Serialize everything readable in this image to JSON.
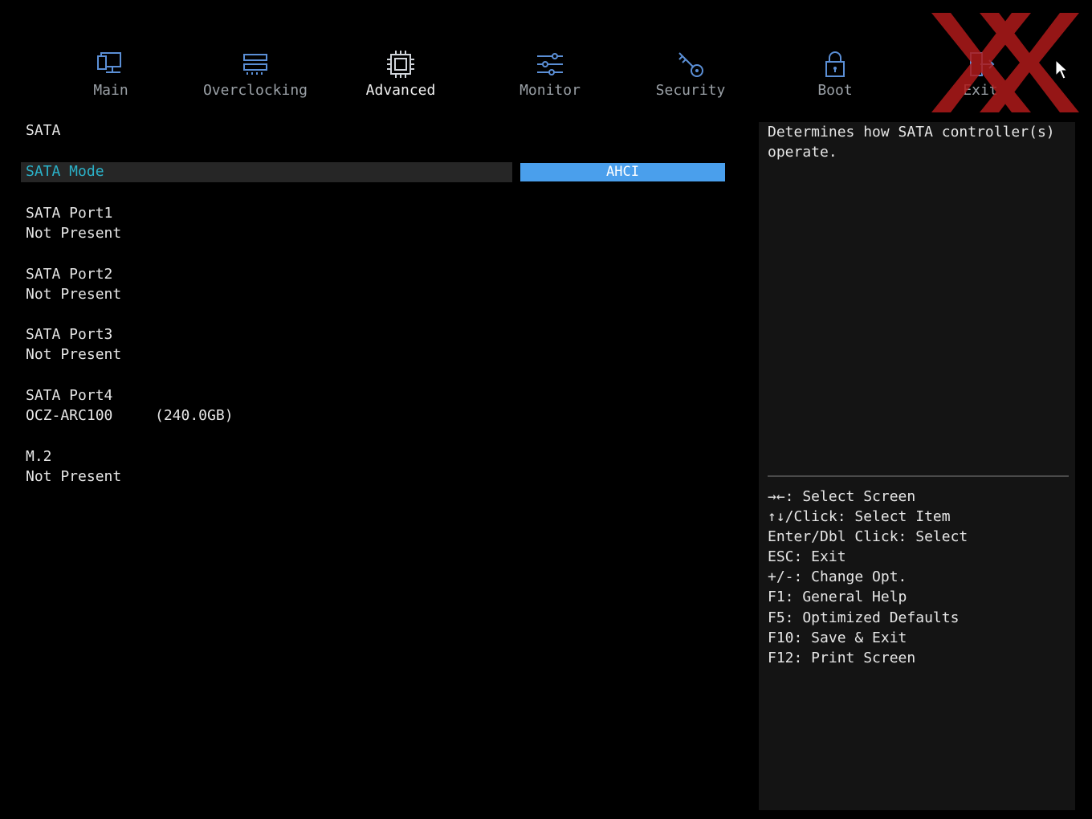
{
  "nav": {
    "tabs": [
      {
        "label": "Main",
        "icon": "monitor-icon"
      },
      {
        "label": "Overclocking",
        "icon": "memory-icon"
      },
      {
        "label": "Advanced",
        "icon": "chip-icon",
        "active": true
      },
      {
        "label": "Monitor",
        "icon": "sliders-icon"
      },
      {
        "label": "Security",
        "icon": "key-icon"
      },
      {
        "label": "Boot",
        "icon": "lock-icon"
      },
      {
        "label": "Exit",
        "icon": "exit-icon"
      }
    ]
  },
  "main": {
    "section_title": "SATA",
    "sata_mode": {
      "label": "SATA Mode",
      "value": "AHCI"
    },
    "ports": [
      {
        "name": "SATA Port1",
        "status": "Not Present",
        "size": ""
      },
      {
        "name": "SATA Port2",
        "status": "Not Present",
        "size": ""
      },
      {
        "name": "SATA Port3",
        "status": "Not Present",
        "size": ""
      },
      {
        "name": "SATA Port4",
        "status": "OCZ-ARC100",
        "size": "(240.0GB)"
      },
      {
        "name": "M.2",
        "status": "Not Present",
        "size": ""
      }
    ]
  },
  "help": {
    "description": "Determines how SATA controller(s) operate.",
    "keys": [
      "→←: Select Screen",
      "↑↓/Click: Select Item",
      "Enter/Dbl Click: Select",
      "ESC: Exit",
      "+/-: Change Opt.",
      "F1: General Help",
      "F5: Optimized Defaults",
      "F10: Save & Exit",
      "F12: Print Screen"
    ]
  },
  "colors": {
    "background": "#000000",
    "highlight_label": "#2bb2c9",
    "selected_value": "#4a9fec",
    "icon": "#5b8fd6",
    "watermark": "#b01a1a"
  }
}
